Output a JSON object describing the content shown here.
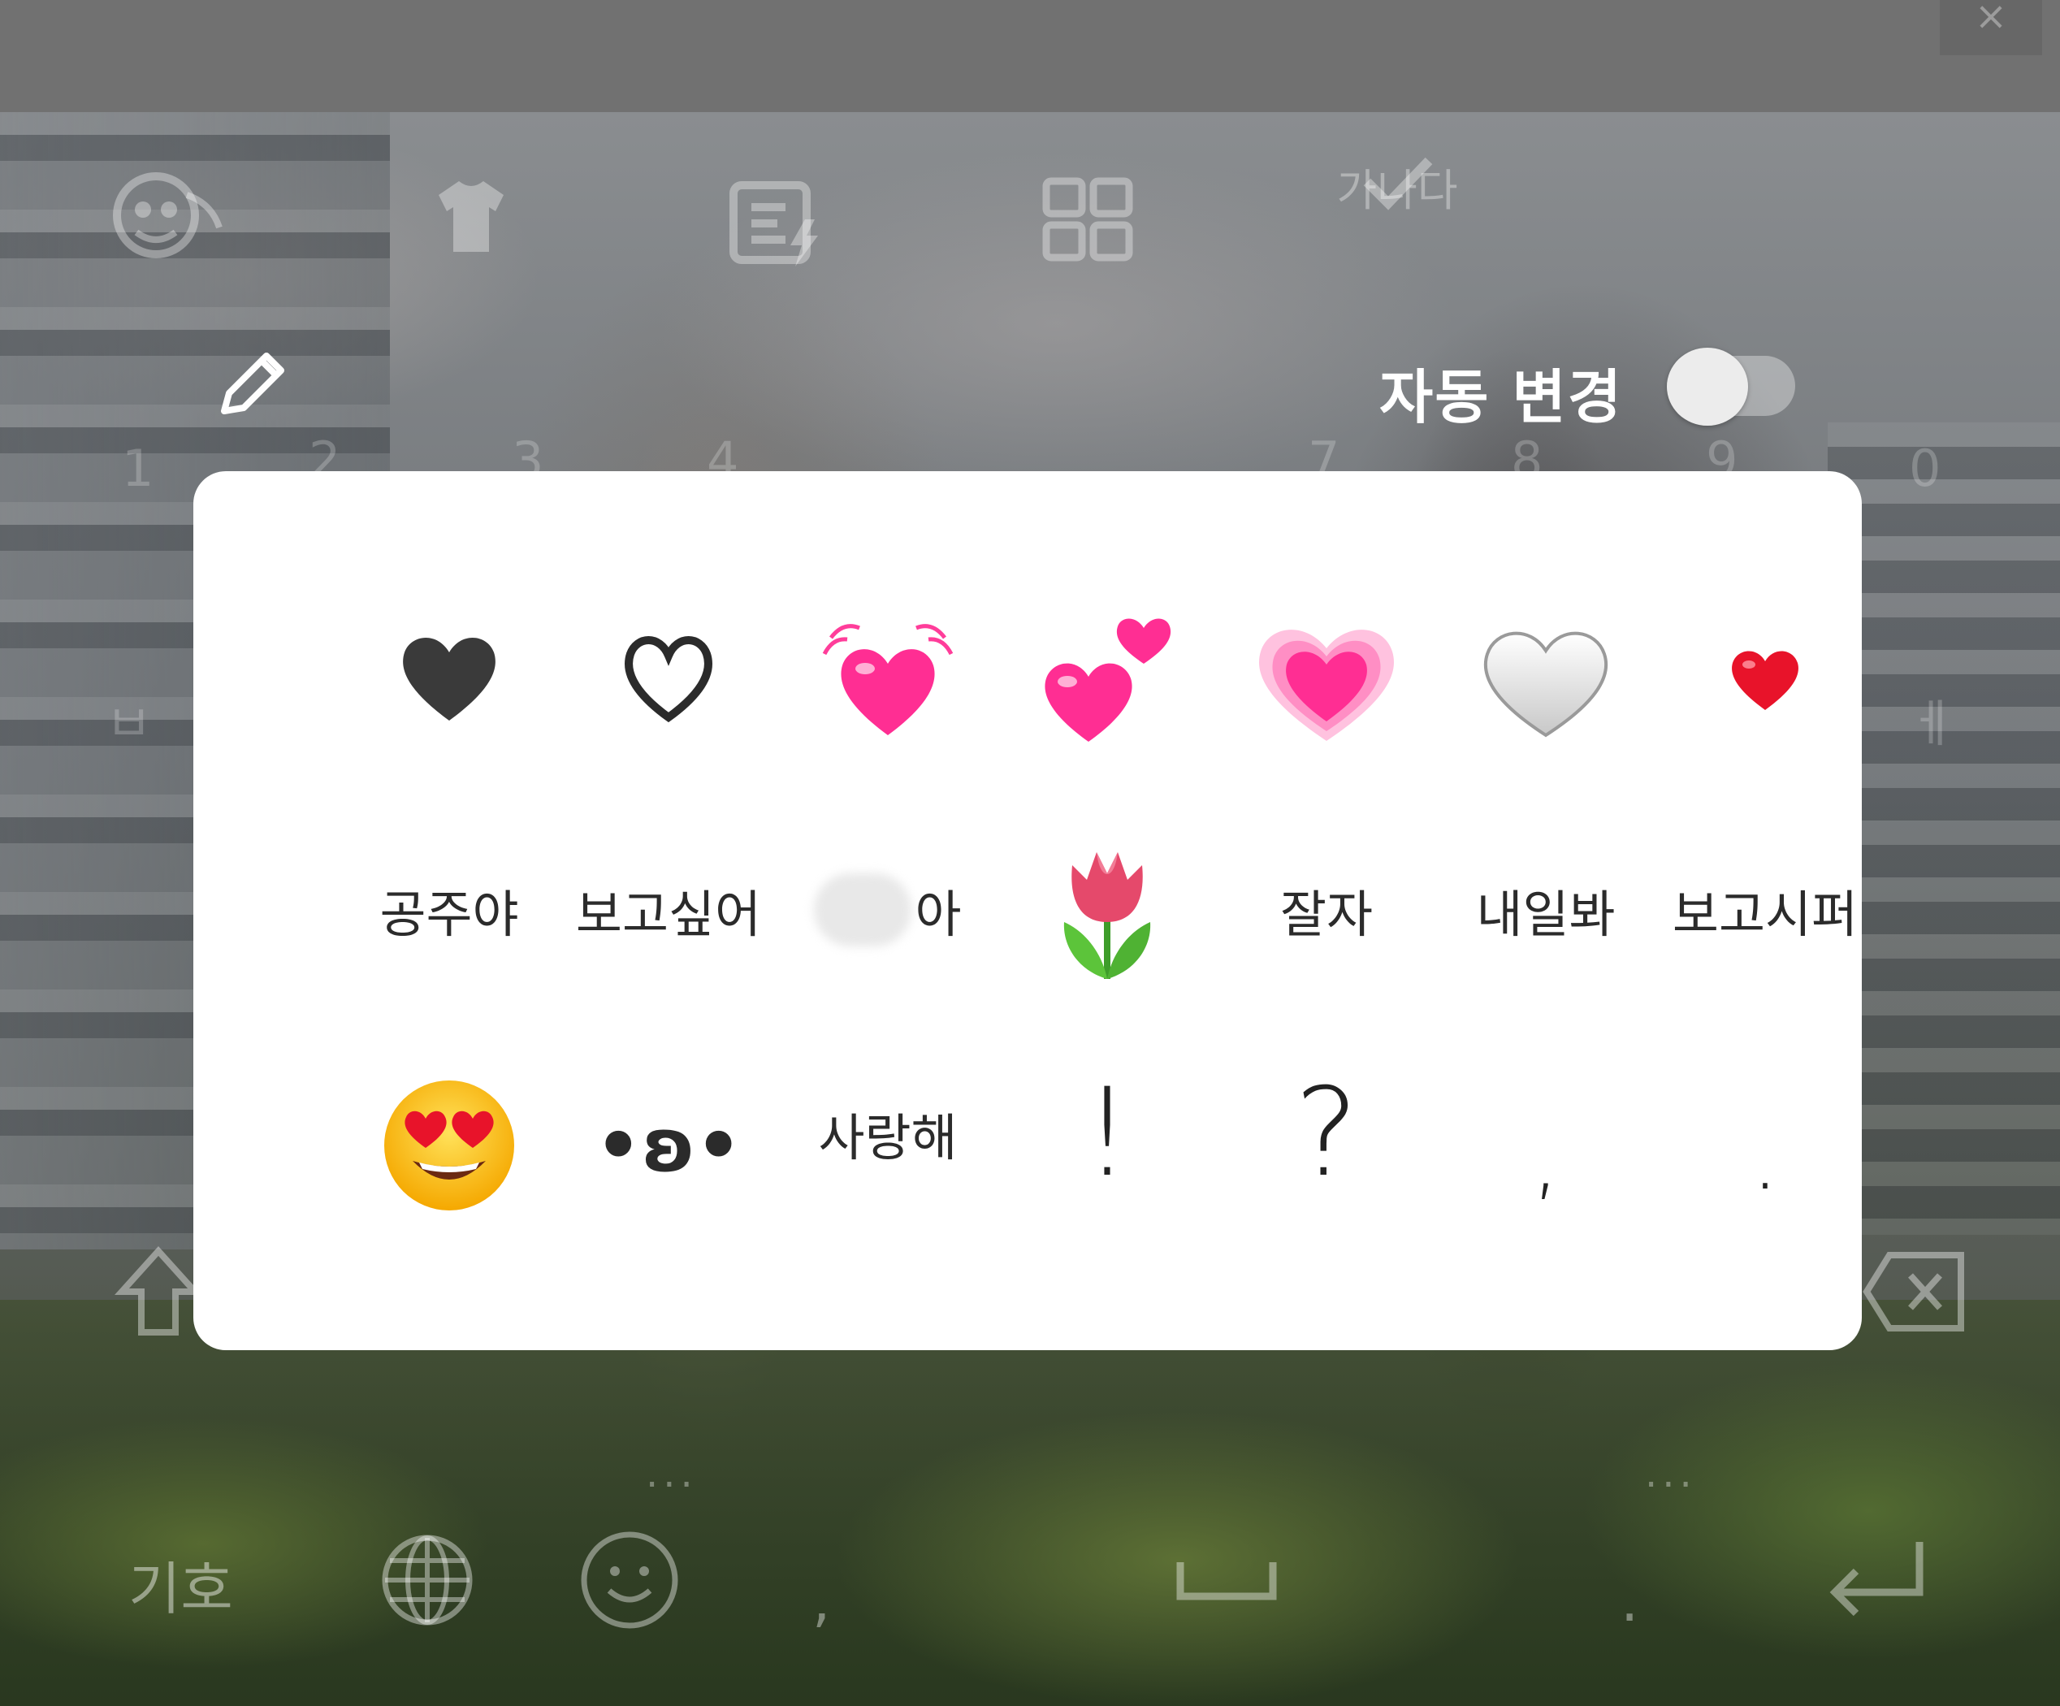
{
  "toolbar": {
    "icons": [
      "emoji-face-icon",
      "theme-tshirt-icon",
      "quick-phrase-icon",
      "clipboard-grid-icon",
      "checkmark-icon"
    ],
    "ganada_label": "가나다",
    "close_glyph": "×"
  },
  "auto_change": {
    "label": "자동 변경",
    "enabled": false
  },
  "background_keys": {
    "digits": [
      "1",
      "2",
      "3",
      "4",
      "7",
      "8",
      "9",
      "0"
    ],
    "letters": [
      "ㅂ",
      "ㅔ"
    ]
  },
  "phrase_panel": {
    "row1": [
      {
        "type": "icon",
        "name": "black-heart-icon"
      },
      {
        "type": "icon",
        "name": "outline-heart-icon"
      },
      {
        "type": "icon",
        "name": "beating-heart-icon"
      },
      {
        "type": "icon",
        "name": "two-hearts-icon"
      },
      {
        "type": "icon",
        "name": "growing-heart-icon"
      },
      {
        "type": "icon",
        "name": "white-heart-icon"
      },
      {
        "type": "icon",
        "name": "small-red-heart-icon"
      }
    ],
    "row2": [
      {
        "type": "text",
        "label": "공주야"
      },
      {
        "type": "text",
        "label": "보고싶어"
      },
      {
        "type": "text",
        "label": "아",
        "redacted": true
      },
      {
        "type": "icon",
        "name": "tulip-icon"
      },
      {
        "type": "text",
        "label": "잘자"
      },
      {
        "type": "text",
        "label": "내일봐"
      },
      {
        "type": "text",
        "label": "보고시퍼"
      }
    ],
    "row3": [
      {
        "type": "icon",
        "name": "heart-eyes-emoji-icon"
      },
      {
        "type": "text",
        "label": "•ʚ•"
      },
      {
        "type": "text",
        "label": "사랑해"
      },
      {
        "type": "text",
        "label": "!"
      },
      {
        "type": "text",
        "label": "?"
      },
      {
        "type": "text",
        "label": ","
      },
      {
        "type": "text",
        "label": "."
      }
    ]
  },
  "bottom_row": {
    "symbol_label": "기호",
    "comma": ",",
    "period": ".",
    "icons": [
      "globe-icon",
      "emoji-smile-icon",
      "space-icon",
      "enter-icon",
      "shift-icon",
      "backspace-icon"
    ]
  },
  "colors": {
    "panel_bg": "#ffffff",
    "heart_pink": "#ff3d9a",
    "heart_red": "#e8132a"
  }
}
